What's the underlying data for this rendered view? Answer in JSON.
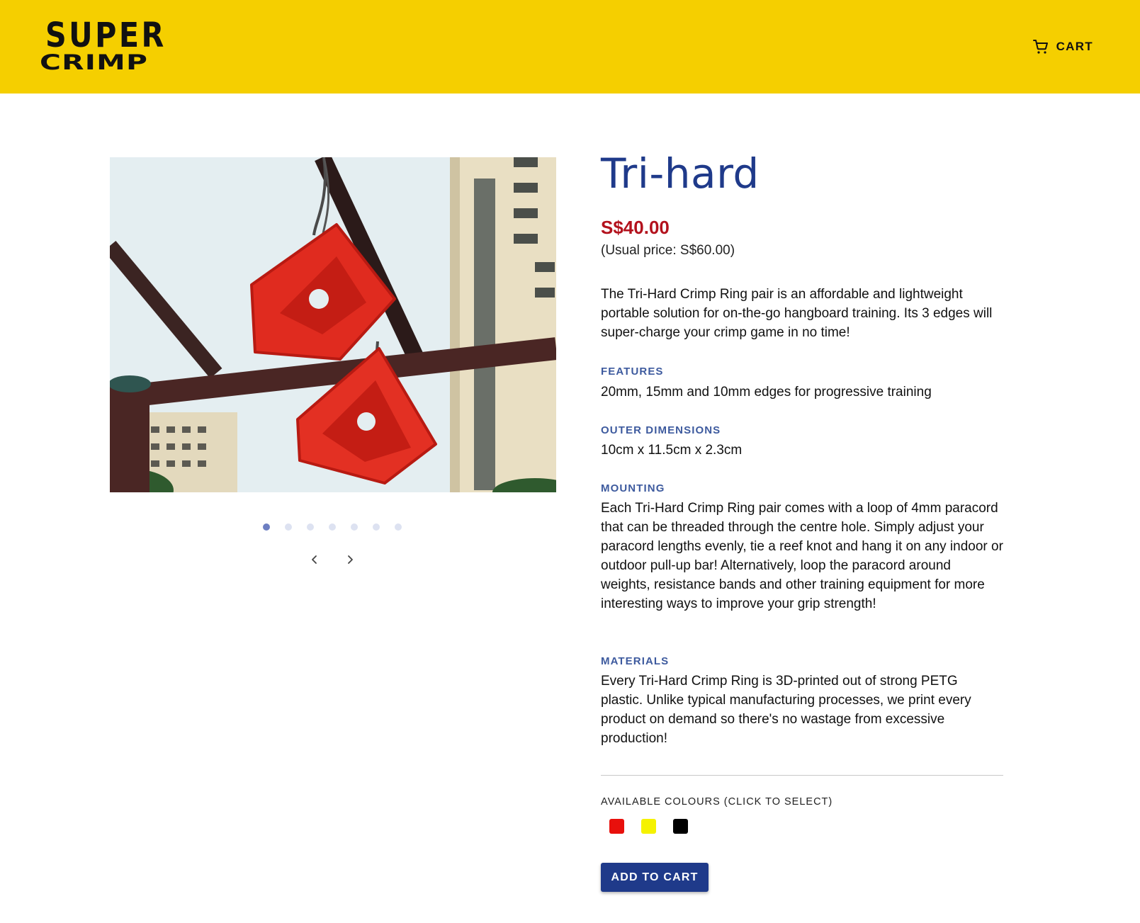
{
  "brand": {
    "line1": "SUPER",
    "line2": "CRIMP"
  },
  "header": {
    "cart_label": "CART",
    "cart_icon": "shopping-cart-icon"
  },
  "gallery": {
    "slide_count": 7,
    "active_index": 0
  },
  "product": {
    "title": "Tri-hard",
    "price": "S$40.00",
    "usual_price": "(Usual price: S$60.00)",
    "description": "The Tri-Hard Crimp Ring pair is an affordable and lightweight portable solution for on-the-go hangboard training. Its 3 edges will super-charge your crimp game in no time!",
    "sections": [
      {
        "heading": "FEATURES",
        "body": "20mm, 15mm and 10mm edges for progressive training"
      },
      {
        "heading": "OUTER DIMENSIONS",
        "body": "10cm x 11.5cm x 2.3cm"
      },
      {
        "heading": "MOUNTING",
        "body": "Each Tri-Hard Crimp Ring pair comes with a loop of 4mm paracord that can be threaded through the centre hole. Simply adjust your paracord lengths evenly, tie a reef knot and hang it on any indoor or outdoor pull-up bar! Alternatively, loop the paracord around weights, resistance bands and other training equipment for more interesting ways to improve your grip strength!"
      },
      {
        "heading": "MATERIALS",
        "body": "Every Tri-Hard Crimp Ring is 3D-printed out of strong PETG plastic. Unlike typical manufacturing processes, we print every product on demand so there's no wastage from excessive production!"
      }
    ],
    "colours_label": "AVAILABLE COLOURS (CLICK TO SELECT)",
    "colours": [
      "#e8100c",
      "#f5f200",
      "#000000"
    ],
    "add_to_cart_label": "ADD TO CART"
  },
  "theme": {
    "header_bg": "#f5cf00",
    "title_color": "#1f3a8a",
    "price_color": "#b3121d",
    "section_color": "#3d5a9e",
    "button_bg": "#1f3a8a"
  }
}
